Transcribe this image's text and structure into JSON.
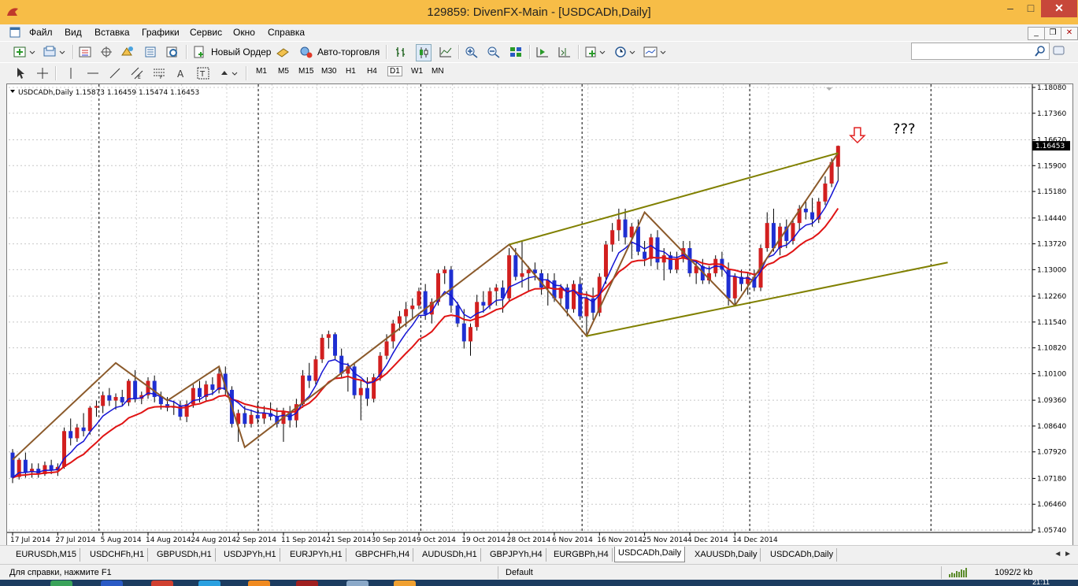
{
  "window": {
    "title": "129859: DivenFX-Main - [USDCADh,Daily]",
    "min_label": "–",
    "max_label": "□",
    "close_label": "✕"
  },
  "menu": [
    "Файл",
    "Вид",
    "Вставка",
    "Графики",
    "Сервис",
    "Окно",
    "Справка"
  ],
  "toolbar": {
    "new_order": "Новый Ордер",
    "auto_trading": "Авто-торговля"
  },
  "timeframes": [
    "M1",
    "M5",
    "M15",
    "M30",
    "H1",
    "H4",
    "D1",
    "W1",
    "MN"
  ],
  "active_timeframe": "D1",
  "chart_data": {
    "type": "candlestick",
    "header": "USDCADh,Daily  1.15873 1.16459 1.15474 1.16453",
    "symbol": "USDCADh,Daily",
    "ohlc_text": "1.15873 1.16459 1.15474 1.16453",
    "last_price": "1.16453",
    "y_ticks": [
      "1.18080",
      "1.17360",
      "1.16620",
      "1.15900",
      "1.15180",
      "1.14440",
      "1.13720",
      "1.13000",
      "1.12260",
      "1.11540",
      "1.10820",
      "1.10100",
      "1.09360",
      "1.08640",
      "1.07920",
      "1.07180",
      "1.06460",
      "1.05740"
    ],
    "ylim": [
      1.0574,
      1.1808
    ],
    "x_ticks": [
      "17 Jul 2014",
      "27 Jul 2014",
      "5 Aug 2014",
      "14 Aug 2014",
      "24 Aug 2014",
      "2 Sep 2014",
      "11 Sep 2014",
      "21 Sep 2014",
      "30 Sep 2014",
      "9 Oct 2014",
      "19 Oct 2014",
      "28 Oct 2014",
      "6 Nov 2014",
      "16 Nov 2014",
      "25 Nov 2014",
      "4 Dec 2014",
      "14 Dec 2014"
    ],
    "annotation": "???",
    "grid": true,
    "colors": {
      "bull": "#d21f1f",
      "bear": "#1f2fd2",
      "ma_fast": "#1414d4",
      "ma_slow": "#e01414",
      "zigzag": "#8b5a2b",
      "channel": "#808000",
      "arrow": "#e02020"
    },
    "candles": [
      [
        1.079,
        1.08,
        1.0705,
        1.072
      ],
      [
        1.0722,
        1.0775,
        1.0715,
        1.077
      ],
      [
        1.077,
        1.079,
        1.072,
        1.0735
      ],
      [
        1.0735,
        1.076,
        1.072,
        1.0745
      ],
      [
        1.0745,
        1.076,
        1.072,
        1.073
      ],
      [
        1.073,
        1.0765,
        1.0725,
        1.0755
      ],
      [
        1.0755,
        1.077,
        1.073,
        1.074
      ],
      [
        1.074,
        1.076,
        1.0725,
        1.075
      ],
      [
        1.075,
        1.086,
        1.0745,
        1.085
      ],
      [
        1.085,
        1.0885,
        1.081,
        1.083
      ],
      [
        1.083,
        1.087,
        1.082,
        1.086
      ],
      [
        1.086,
        1.09,
        1.0835,
        1.085
      ],
      [
        1.085,
        1.092,
        1.084,
        1.0915
      ],
      [
        1.0915,
        1.0935,
        1.089,
        1.092
      ],
      [
        1.092,
        1.096,
        1.09,
        1.095
      ],
      [
        1.095,
        1.097,
        1.092,
        1.0935
      ],
      [
        1.0935,
        1.0955,
        1.091,
        1.0945
      ],
      [
        1.0945,
        1.0965,
        1.092,
        1.093
      ],
      [
        1.093,
        1.0995,
        1.092,
        1.099
      ],
      [
        1.099,
        1.102,
        1.093,
        1.094
      ],
      [
        1.094,
        1.096,
        1.0925,
        1.095
      ],
      [
        1.095,
        1.1,
        1.094,
        1.099
      ],
      [
        1.099,
        1.1005,
        1.093,
        1.0945
      ],
      [
        1.0945,
        1.096,
        1.091,
        1.0925
      ],
      [
        1.0925,
        1.0945,
        1.0905,
        1.0915
      ],
      [
        1.0915,
        1.0935,
        1.0895,
        1.092
      ],
      [
        1.092,
        1.0935,
        1.088,
        1.089
      ],
      [
        1.089,
        1.0935,
        1.0875,
        1.0925
      ],
      [
        1.0925,
        1.098,
        1.0915,
        1.097
      ],
      [
        1.097,
        1.099,
        1.093,
        1.0945
      ],
      [
        1.0945,
        1.099,
        1.0935,
        1.098
      ],
      [
        1.098,
        1.1,
        1.095,
        1.0965
      ],
      [
        1.0965,
        1.1025,
        1.0955,
        1.101
      ],
      [
        1.101,
        1.103,
        1.095,
        1.0965
      ],
      [
        1.0965,
        1.0975,
        1.086,
        1.087
      ],
      [
        1.087,
        1.091,
        1.082,
        1.09
      ],
      [
        1.09,
        1.092,
        1.086,
        1.087
      ],
      [
        1.087,
        1.091,
        1.086,
        1.0895
      ],
      [
        1.0895,
        1.093,
        1.087,
        1.0885
      ],
      [
        1.0885,
        1.092,
        1.087,
        1.09
      ],
      [
        1.09,
        1.093,
        1.088,
        1.089
      ],
      [
        1.089,
        1.0915,
        1.086,
        1.087
      ],
      [
        1.087,
        1.0915,
        1.082,
        1.0905
      ],
      [
        1.0905,
        1.092,
        1.086,
        1.088
      ],
      [
        1.088,
        1.094,
        1.086,
        1.0925
      ],
      [
        1.0925,
        1.102,
        1.0915,
        1.1005
      ],
      [
        1.1005,
        1.104,
        1.097,
        1.099
      ],
      [
        1.099,
        1.106,
        1.098,
        1.105
      ],
      [
        1.105,
        1.112,
        1.104,
        1.111
      ],
      [
        1.111,
        1.113,
        1.108,
        1.112
      ],
      [
        1.112,
        1.1125,
        1.105,
        1.106
      ],
      [
        1.106,
        1.108,
        1.1,
        1.101
      ],
      [
        1.101,
        1.104,
        1.096,
        1.103
      ],
      [
        1.103,
        1.104,
        1.094,
        1.095
      ],
      [
        1.095,
        1.099,
        1.088,
        1.097
      ],
      [
        1.097,
        1.1,
        1.092,
        1.094
      ],
      [
        1.094,
        1.101,
        1.093,
        1.1
      ],
      [
        1.1,
        1.107,
        1.099,
        1.106
      ],
      [
        1.106,
        1.112,
        1.105,
        1.11
      ],
      [
        1.11,
        1.116,
        1.108,
        1.115
      ],
      [
        1.115,
        1.1185,
        1.113,
        1.117
      ],
      [
        1.117,
        1.121,
        1.114,
        1.119
      ],
      [
        1.119,
        1.122,
        1.116,
        1.12
      ],
      [
        1.12,
        1.125,
        1.119,
        1.124
      ],
      [
        1.124,
        1.126,
        1.116,
        1.1175
      ],
      [
        1.1175,
        1.122,
        1.115,
        1.121
      ],
      [
        1.121,
        1.13,
        1.12,
        1.129
      ],
      [
        1.129,
        1.131,
        1.126,
        1.13
      ],
      [
        1.13,
        1.131,
        1.118,
        1.12
      ],
      [
        1.12,
        1.121,
        1.114,
        1.115
      ],
      [
        1.115,
        1.119,
        1.108,
        1.11
      ],
      [
        1.11,
        1.115,
        1.106,
        1.114
      ],
      [
        1.114,
        1.123,
        1.113,
        1.121
      ],
      [
        1.121,
        1.124,
        1.118,
        1.12
      ],
      [
        1.12,
        1.125,
        1.119,
        1.124
      ],
      [
        1.124,
        1.126,
        1.12,
        1.125
      ],
      [
        1.125,
        1.127,
        1.118,
        1.122
      ],
      [
        1.122,
        1.136,
        1.121,
        1.134
      ],
      [
        1.134,
        1.136,
        1.127,
        1.128
      ],
      [
        1.128,
        1.138,
        1.125,
        1.129
      ],
      [
        1.129,
        1.131,
        1.124,
        1.13
      ],
      [
        1.13,
        1.132,
        1.127,
        1.129
      ],
      [
        1.129,
        1.13,
        1.123,
        1.125
      ],
      [
        1.125,
        1.129,
        1.12,
        1.127
      ],
      [
        1.127,
        1.129,
        1.121,
        1.122
      ],
      [
        1.122,
        1.126,
        1.12,
        1.125
      ],
      [
        1.125,
        1.126,
        1.117,
        1.119
      ],
      [
        1.119,
        1.127,
        1.118,
        1.126
      ],
      [
        1.126,
        1.128,
        1.116,
        1.117
      ],
      [
        1.117,
        1.124,
        1.112,
        1.122
      ],
      [
        1.122,
        1.125,
        1.116,
        1.118
      ],
      [
        1.118,
        1.129,
        1.117,
        1.128
      ],
      [
        1.128,
        1.138,
        1.126,
        1.137
      ],
      [
        1.137,
        1.143,
        1.135,
        1.141
      ],
      [
        1.141,
        1.147,
        1.138,
        1.144
      ],
      [
        1.144,
        1.147,
        1.137,
        1.139
      ],
      [
        1.139,
        1.143,
        1.133,
        1.142
      ],
      [
        1.142,
        1.144,
        1.134,
        1.135
      ],
      [
        1.135,
        1.138,
        1.131,
        1.133
      ],
      [
        1.133,
        1.14,
        1.131,
        1.139
      ],
      [
        1.139,
        1.141,
        1.13,
        1.132
      ],
      [
        1.132,
        1.136,
        1.127,
        1.134
      ],
      [
        1.134,
        1.135,
        1.129,
        1.13
      ],
      [
        1.13,
        1.135,
        1.129,
        1.133
      ],
      [
        1.133,
        1.138,
        1.132,
        1.136
      ],
      [
        1.136,
        1.138,
        1.128,
        1.129
      ],
      [
        1.129,
        1.132,
        1.126,
        1.131
      ],
      [
        1.131,
        1.133,
        1.126,
        1.127
      ],
      [
        1.127,
        1.131,
        1.126,
        1.129
      ],
      [
        1.129,
        1.134,
        1.128,
        1.133
      ],
      [
        1.133,
        1.135,
        1.128,
        1.13
      ],
      [
        1.13,
        1.132,
        1.12,
        1.122
      ],
      [
        1.122,
        1.129,
        1.12,
        1.128
      ],
      [
        1.128,
        1.13,
        1.124,
        1.126
      ],
      [
        1.126,
        1.129,
        1.123,
        1.128
      ],
      [
        1.128,
        1.13,
        1.124,
        1.125
      ],
      [
        1.125,
        1.137,
        1.124,
        1.136
      ],
      [
        1.136,
        1.146,
        1.135,
        1.143
      ],
      [
        1.143,
        1.147,
        1.135,
        1.136
      ],
      [
        1.136,
        1.143,
        1.134,
        1.142
      ],
      [
        1.142,
        1.144,
        1.136,
        1.138
      ],
      [
        1.138,
        1.144,
        1.137,
        1.143
      ],
      [
        1.143,
        1.148,
        1.141,
        1.147
      ],
      [
        1.147,
        1.149,
        1.144,
        1.146
      ],
      [
        1.146,
        1.15,
        1.142,
        1.144
      ],
      [
        1.144,
        1.15,
        1.143,
        1.149
      ],
      [
        1.149,
        1.156,
        1.148,
        1.154
      ],
      [
        1.154,
        1.161,
        1.153,
        1.16
      ],
      [
        1.1587,
        1.1646,
        1.1547,
        1.1645
      ]
    ],
    "zigzag": [
      [
        0,
        1.077
      ],
      [
        16,
        1.104
      ],
      [
        24,
        1.0935
      ],
      [
        32,
        1.103
      ],
      [
        36,
        1.0805
      ],
      [
        77,
        1.137
      ],
      [
        89,
        1.1115
      ],
      [
        98,
        1.146
      ],
      [
        112,
        1.12
      ],
      [
        128,
        1.1625
      ]
    ],
    "channel_upper": [
      [
        77,
        1.137
      ],
      [
        128,
        1.1625
      ]
    ],
    "channel_lower": [
      [
        89,
        1.1115
      ],
      [
        145,
        1.132
      ]
    ]
  },
  "tabs": [
    "EURUSDh,M15",
    "USDCHFh,H1",
    "GBPUSDh,H1",
    "USDJPYh,H1",
    "EURJPYh,H1",
    "GBPCHFh,H4",
    "AUDUSDh,H1",
    "GBPJPYh,H4",
    "EURGBPh,H4",
    "USDCADh,Daily",
    "XAUUSDh,Daily",
    "USDCADh,Daily"
  ],
  "active_tab": 9,
  "status": {
    "help": "Для справки, нажмите F1",
    "profile": "Default",
    "traffic": "1092/2 kb"
  },
  "clock": "21:11"
}
